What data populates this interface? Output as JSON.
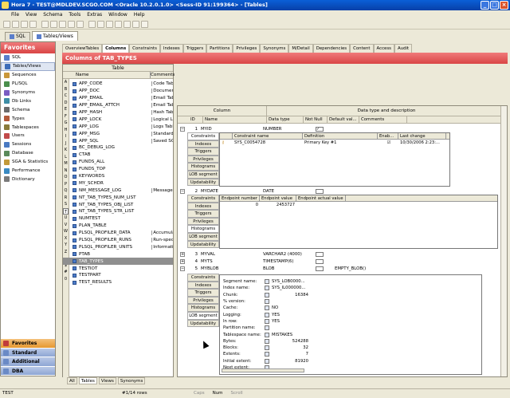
{
  "window": {
    "title": "Hora 7 - TEST@MDLDEV.SCGO.COM <Oracle 10.2.0.1.0> <Sess-ID 91:199364> - [Tables]"
  },
  "menu": [
    "File",
    "View",
    "Schema",
    "Tools",
    "Extras",
    "Window",
    "Help"
  ],
  "doc_tabs": [
    {
      "label": "SQL",
      "active": false
    },
    {
      "label": "Tables/Views",
      "active": true
    }
  ],
  "sidebar": {
    "title": "Favorites",
    "items": [
      {
        "label": "SQL",
        "icon": "sql-icon",
        "color": "#5a7ecb",
        "selected": false
      },
      {
        "label": "Tables/Views",
        "icon": "table-icon",
        "color": "#3d6db9",
        "selected": true
      },
      {
        "label": "Sequences",
        "icon": "sequence-icon",
        "color": "#c9973a",
        "selected": false
      },
      {
        "label": "PL/SQL",
        "icon": "plsql-icon",
        "color": "#4b8f4b",
        "selected": false
      },
      {
        "label": "Synonyms",
        "icon": "synonym-icon",
        "color": "#7a5cc2",
        "selected": false
      },
      {
        "label": "Db Links",
        "icon": "link-icon",
        "color": "#3e8ea6",
        "selected": false
      },
      {
        "label": "Schema",
        "icon": "schema-icon",
        "color": "#6b6b6b",
        "selected": false
      },
      {
        "label": "Types",
        "icon": "types-icon",
        "color": "#b35a3a",
        "selected": false
      },
      {
        "label": "Tablespaces",
        "icon": "tablespace-icon",
        "color": "#8a7a3a",
        "selected": false
      },
      {
        "label": "Users",
        "icon": "users-icon",
        "color": "#c24a4a",
        "selected": false
      },
      {
        "label": "Sessions",
        "icon": "sessions-icon",
        "color": "#4a7ac2",
        "selected": false
      },
      {
        "label": "Database",
        "icon": "database-icon",
        "color": "#5a8a5a",
        "selected": false
      },
      {
        "label": "SGA & Statistics",
        "icon": "sga-icon",
        "color": "#c29a3a",
        "selected": false
      },
      {
        "label": "Performance",
        "icon": "performance-icon",
        "color": "#3a8ac2",
        "selected": false
      },
      {
        "label": "Dictionary",
        "icon": "dictionary-icon",
        "color": "#7a7a7a",
        "selected": false
      }
    ],
    "groups": [
      {
        "label": "Favorites",
        "style": "red"
      },
      {
        "label": "Standard",
        "style": "blue"
      },
      {
        "label": "Additional",
        "style": "blue"
      },
      {
        "label": "DBA",
        "style": "blue"
      }
    ]
  },
  "object_tabs": [
    "OverviewTables",
    "Columns",
    "Constraints",
    "Indexes",
    "Triggers",
    "Partitions",
    "Privileges",
    "Synonyms",
    "M/Detail",
    "Dependencies",
    "Content",
    "Access",
    "Audit"
  ],
  "object_tab_active": "Columns",
  "columns_header": "Columns of TAB_TYPES",
  "table_panel": {
    "title": "Table",
    "col_name": "Name",
    "col_comments": "Comments",
    "letters": [
      "A",
      "B",
      "C",
      "D",
      "E",
      "F",
      "G",
      "H",
      "I",
      "J",
      "K",
      "L",
      "M",
      "N",
      "O",
      "P",
      "Q",
      "R",
      "S",
      "T",
      "U",
      "V",
      "W",
      "X",
      "Y",
      "Z",
      "_",
      "$",
      "#",
      "0"
    ],
    "selected_letter": "T",
    "rows": [
      {
        "name": "APP_CODE",
        "comment": "Code Table"
      },
      {
        "name": "APP_DOC",
        "comment": "Document"
      },
      {
        "name": "APP_EMAIL",
        "comment": "Email Table"
      },
      {
        "name": "APP_EMAIL_ATTCH",
        "comment": "Email Table"
      },
      {
        "name": "APP_HASH",
        "comment": "Hash Table"
      },
      {
        "name": "APP_LOCK",
        "comment": "Logical Loc"
      },
      {
        "name": "APP_LOG",
        "comment": "Logs Table"
      },
      {
        "name": "APP_MSG",
        "comment": "Standard M"
      },
      {
        "name": "APP_SQL",
        "comment": "Saved SQL"
      },
      {
        "name": "BC_DEBUG_LOG",
        "comment": ""
      },
      {
        "name": "CTAB",
        "comment": ""
      },
      {
        "name": "FUNDS_ALL",
        "comment": ""
      },
      {
        "name": "FUNDS_TOP",
        "comment": ""
      },
      {
        "name": "KEYWORDS",
        "comment": ""
      },
      {
        "name": "MY_SCHDR",
        "comment": ""
      },
      {
        "name": "NM_MESSAGE_LOG",
        "comment": "Message L"
      },
      {
        "name": "NT_TAB_TYPES_NUM_LIST",
        "comment": ""
      },
      {
        "name": "NT_TAB_TYPES_OBJ_LIST",
        "comment": ""
      },
      {
        "name": "NT_TAB_TYPES_STR_LIST",
        "comment": ""
      },
      {
        "name": "NUMTEST",
        "comment": ""
      },
      {
        "name": "PLAN_TABLE",
        "comment": ""
      },
      {
        "name": "PLSQL_PROFILER_DATA",
        "comment": "Accumulate"
      },
      {
        "name": "PLSQL_PROFILER_RUNS",
        "comment": "Run-specif"
      },
      {
        "name": "PLSQL_PROFILER_UNITS",
        "comment": "Information"
      },
      {
        "name": "PTAB",
        "comment": ""
      },
      {
        "name": "TAB_TYPES",
        "comment": "",
        "selected": true
      },
      {
        "name": "TESTIOT",
        "comment": ""
      },
      {
        "name": "TESTPART",
        "comment": ""
      },
      {
        "name": "TEST_RESULTS",
        "comment": ""
      }
    ],
    "footer_tabs": [
      "All",
      "Tables",
      "Views",
      "Synonyms"
    ],
    "footer_active": "Tables"
  },
  "main": {
    "group_column": "Column",
    "group_datatype": "Data type and description",
    "headers": [
      "ID",
      "Name",
      "Data type",
      "Not Null",
      "Default val...",
      "Comments"
    ],
    "columns": [
      {
        "id": "1",
        "name": "MYID",
        "datatype": "NUMBER",
        "notnull": true,
        "default": ""
      },
      {
        "id": "2",
        "name": "MYDATE",
        "datatype": "DATE",
        "notnull": false,
        "default": ""
      },
      {
        "id": "3",
        "name": "MYVAL",
        "datatype": "VARCHAR2 (4000)",
        "notnull": false,
        "default": ""
      },
      {
        "id": "4",
        "name": "MYTS",
        "datatype": "TIMESTAMP(6)",
        "notnull": false,
        "default": ""
      },
      {
        "id": "5",
        "name": "MYBLOB",
        "datatype": "BLOB",
        "notnull": false,
        "default": "EMPTY_BLOB()"
      }
    ],
    "detail_tabs": [
      "Constraints",
      "Indexes",
      "Triggers",
      "Privileges",
      "Histograms",
      "LOB segment",
      "Updatability"
    ],
    "constraints_grid": {
      "headers": [
        "Constraint name",
        "Definition",
        "Enab...",
        "Last change"
      ],
      "row": {
        "name": "SYS_C0054728",
        "definition": "Primary Key #1",
        "enabled": true,
        "last_change": "10/30/2006 2:23:..."
      }
    },
    "histogram_grid": {
      "headers": [
        "Endpoint number",
        "Endpoint value",
        "Endpoint actual value"
      ],
      "row": {
        "number": "0",
        "value": "2453727",
        "actual": ""
      }
    },
    "lob_segment": [
      {
        "label": "Segment name:",
        "value": "SYS_LOB0000...",
        "align": "left"
      },
      {
        "label": "Index name:",
        "value": "SYS_IL000000...",
        "align": "left"
      },
      {
        "label": "Chunk:",
        "value": "16384",
        "align": "right"
      },
      {
        "label": "% version:",
        "value": "",
        "align": "left"
      },
      {
        "label": "Cache:",
        "value": "NO",
        "align": "left"
      },
      {
        "label": "Logging:",
        "value": "YES",
        "align": "left"
      },
      {
        "label": "In row:",
        "value": "YES",
        "align": "left"
      },
      {
        "label": "Partition name:",
        "value": "",
        "align": "left"
      },
      {
        "label": "Tablespace name:",
        "value": "MISTAKES",
        "align": "left"
      },
      {
        "label": "Bytes:",
        "value": "524288",
        "align": "right"
      },
      {
        "label": "Blocks:",
        "value": "32",
        "align": "right"
      },
      {
        "label": "Extents:",
        "value": "7",
        "align": "right"
      },
      {
        "label": "Initial extent:",
        "value": "81920",
        "align": "right"
      },
      {
        "label": "Next extent:",
        "value": "",
        "align": "right"
      }
    ]
  },
  "status": {
    "user": "TEST",
    "record": "#1/14 rows",
    "caps": "Caps",
    "num": "Num",
    "scroll": "Scroll"
  }
}
